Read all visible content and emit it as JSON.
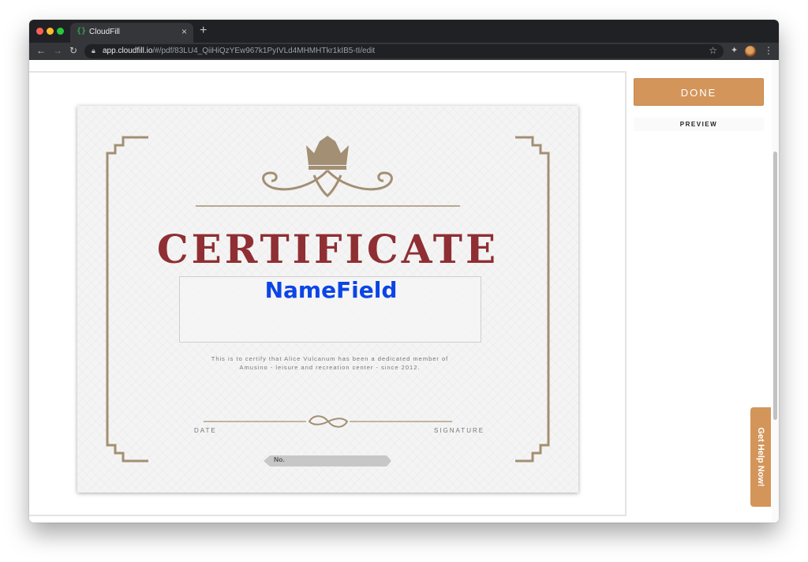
{
  "browser": {
    "tab_title": "CloudFill",
    "tab_icon": "{}",
    "tab_close": "×",
    "new_tab": "+",
    "url_host": "app.cloudfill.io",
    "url_path": "/#/pdf/83LU4_QiiHiQzYEw967k1PyIVLd4MHMHTkr1kIB5-tI/edit",
    "icons": [
      "back-arrow-icon",
      "forward-arrow-icon",
      "reload-icon",
      "lock-icon",
      "star-icon",
      "extensions-icon",
      "profile-avatar",
      "menu-icon"
    ]
  },
  "certificate": {
    "title": "CERTIFICATE",
    "name_field": "NameField",
    "body_line1": "This is to certify that Alice Vulcanum has been a dedicated member of",
    "body_line2": "Amusino - leisure and recreation center - since 2012.",
    "date_label": "DATE",
    "signature_label": "SIGNATURE",
    "number_label": "No.",
    "colors": {
      "title": "#8f2f33",
      "ornament": "#a38f73",
      "name_field": "#0b45e6"
    }
  },
  "panel": {
    "done_label": "DONE",
    "preview_label": "PREVIEW",
    "help_label": "Get Help Now!",
    "accent_color": "#d3955a"
  }
}
